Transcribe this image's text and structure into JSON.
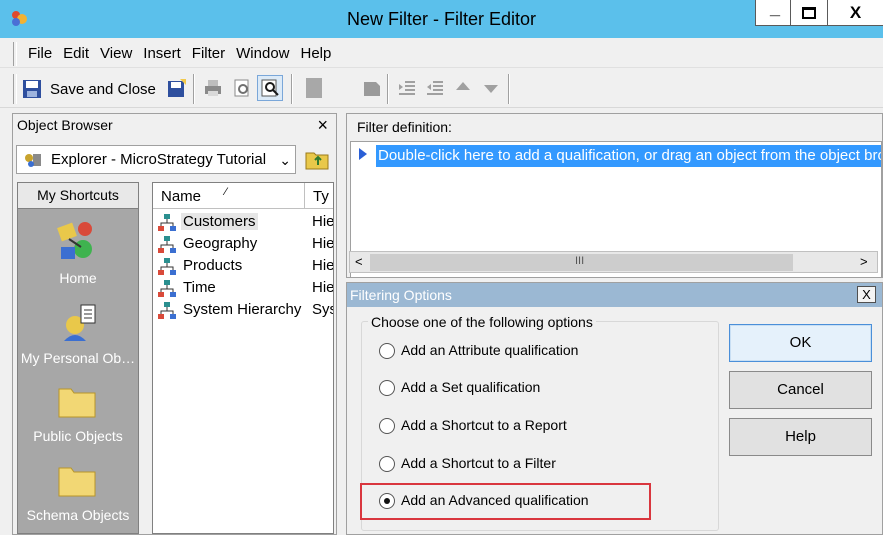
{
  "window": {
    "title": "New Filter - Filter Editor",
    "minimize_glyph": "_",
    "restore_glyph": "□",
    "close_glyph": "X"
  },
  "menu": [
    "File",
    "Edit",
    "View",
    "Insert",
    "Filter",
    "Window",
    "Help"
  ],
  "toolbar": {
    "save_close_label": "Save and Close",
    "icons": [
      "save-icon",
      "save-as-icon",
      "print-icon",
      "print-preview-icon",
      "find-icon",
      "cut-icon",
      "select-icon",
      "indent-icon",
      "outdent-icon",
      "move-up-icon",
      "move-down-icon"
    ]
  },
  "object_browser": {
    "title": "Object Browser",
    "close_glyph": "×",
    "location": "Explorer - MicroStrategy Tutorial",
    "shortcuts_header": "My Shortcuts",
    "shortcuts": [
      {
        "label": "Home",
        "icon": "home-icon"
      },
      {
        "label": "My Personal Ob…",
        "icon": "personal-objects-icon"
      },
      {
        "label": "Public Objects",
        "icon": "folder-icon"
      },
      {
        "label": "Schema Objects",
        "icon": "folder-icon"
      }
    ],
    "columns": [
      "Name",
      "Ty"
    ],
    "rows": [
      {
        "name": "Customers",
        "type": "Hie"
      },
      {
        "name": "Geography",
        "type": "Hie"
      },
      {
        "name": "Products",
        "type": "Hie"
      },
      {
        "name": "Time",
        "type": "Hie"
      },
      {
        "name": "System Hierarchy",
        "type": "Sys"
      }
    ]
  },
  "filter_definition": {
    "label": "Filter definition:",
    "hint": "Double-click here to add a qualification, or drag an object from the object browser",
    "scroll_left": "<",
    "scroll_mid": "III",
    "scroll_right": ">"
  },
  "filtering_options": {
    "title": "Filtering Options",
    "close_glyph": "X",
    "group_label": "Choose one of the following options",
    "options": [
      {
        "label": "Add an Attribute qualification",
        "checked": false
      },
      {
        "label": "Add a Set qualification",
        "checked": false
      },
      {
        "label": "Add a Shortcut to a Report",
        "checked": false
      },
      {
        "label": "Add a Shortcut to a Filter",
        "checked": false
      },
      {
        "label": "Add an Advanced qualification",
        "checked": true
      }
    ],
    "buttons": {
      "ok": "OK",
      "cancel": "Cancel",
      "help": "Help"
    }
  },
  "colors": {
    "titlebar": "#5bc0eb",
    "selection": "#3399ff",
    "highlight_box": "#d9363e",
    "dialog_titlebar": "#9bb8d3"
  }
}
